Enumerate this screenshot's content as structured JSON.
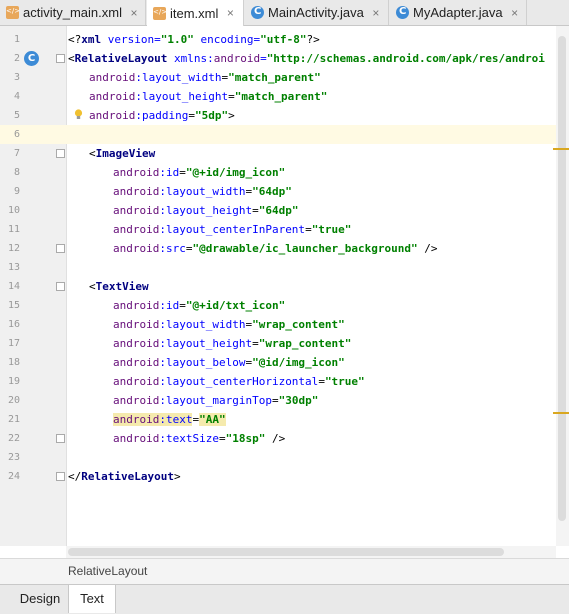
{
  "tabs": [
    {
      "label": "activity_main.xml",
      "icon": "xml-file-icon"
    },
    {
      "label": "item.xml",
      "icon": "xml-file-icon"
    },
    {
      "label": "MainActivity.java",
      "icon": "class-c-icon"
    },
    {
      "label": "MyAdapter.java",
      "icon": "class-c-icon"
    }
  ],
  "close_glyph": "×",
  "line_numbers": [
    "1",
    "2",
    "3",
    "4",
    "5",
    "6",
    "7",
    "8",
    "9",
    "10",
    "11",
    "12",
    "13",
    "14",
    "15",
    "16",
    "17",
    "18",
    "19",
    "20",
    "21",
    "22",
    "23",
    "24"
  ],
  "code": {
    "l1": {
      "open": "<?",
      "name": "xml",
      "attr1": " version=",
      "val1": "\"1.0\"",
      "attr2": " encoding=",
      "val2": "\"utf-8\"",
      "close": "?>"
    },
    "l2": {
      "open": "<",
      "tag": "RelativeLayout",
      "ns": " xmlns:",
      "nsname": "android",
      "eq": "=",
      "val": "\"http://schemas.android.com/apk/res/androi"
    },
    "l3": {
      "ns": "android",
      "attr": ":layout_width",
      "eq": "=",
      "val": "\"match_parent\""
    },
    "l4": {
      "ns": "android",
      "attr": ":layout_height",
      "eq": "=",
      "val": "\"match_parent\""
    },
    "l5": {
      "ns": "android",
      "attr": ":padding",
      "eq": "=",
      "val": "\"5dp\"",
      "close": ">"
    },
    "l7": {
      "open": "<",
      "tag": "ImageView"
    },
    "l8": {
      "ns": "android",
      "attr": ":id",
      "eq": "=",
      "val": "\"@+id/img_icon\""
    },
    "l9": {
      "ns": "android",
      "attr": ":layout_width",
      "eq": "=",
      "val": "\"64dp\""
    },
    "l10": {
      "ns": "android",
      "attr": ":layout_height",
      "eq": "=",
      "val": "\"64dp\""
    },
    "l11": {
      "ns": "android",
      "attr": ":layout_centerInParent",
      "eq": "=",
      "val": "\"true\""
    },
    "l12": {
      "ns": "android",
      "attr": ":src",
      "eq": "=",
      "val": "\"@drawable/ic_launcher_background\"",
      "close": " />"
    },
    "l14": {
      "open": "<",
      "tag": "TextView"
    },
    "l15": {
      "ns": "android",
      "attr": ":id",
      "eq": "=",
      "val": "\"@+id/txt_icon\""
    },
    "l16": {
      "ns": "android",
      "attr": ":layout_width",
      "eq": "=",
      "val": "\"wrap_content\""
    },
    "l17": {
      "ns": "android",
      "attr": ":layout_height",
      "eq": "=",
      "val": "\"wrap_content\""
    },
    "l18": {
      "ns": "android",
      "attr": ":layout_below",
      "eq": "=",
      "val": "\"@id/img_icon\""
    },
    "l19": {
      "ns": "android",
      "attr": ":layout_centerHorizontal",
      "eq": "=",
      "val": "\"true\""
    },
    "l20": {
      "ns": "android",
      "attr": ":layout_marginTop",
      "eq": "=",
      "val": "\"30dp\""
    },
    "l21": {
      "ns": "android",
      "attr": ":text",
      "eq": "=",
      "val": "\"AA\""
    },
    "l22": {
      "ns": "android",
      "attr": ":textSize",
      "eq": "=",
      "val": "\"18sp\"",
      "close": " />"
    },
    "l24": {
      "open": "</",
      "tag": "RelativeLayout",
      "close": ">"
    }
  },
  "gutter_badge": "C",
  "breadcrumb": "RelativeLayout",
  "bottom_tabs": [
    {
      "label": "Design"
    },
    {
      "label": "Text"
    }
  ]
}
